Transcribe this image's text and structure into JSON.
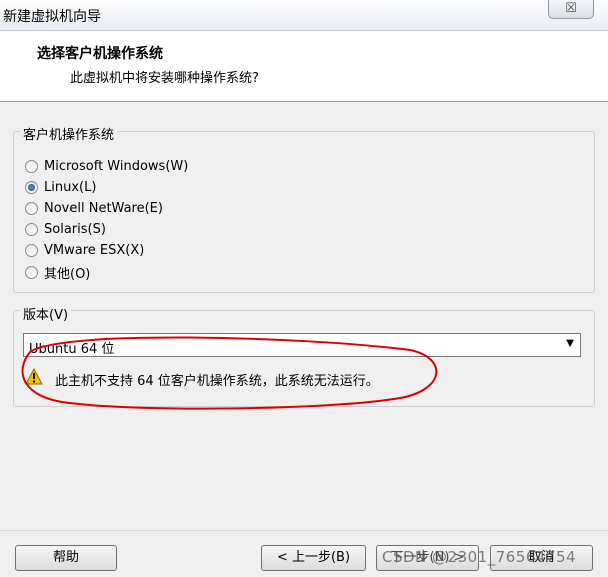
{
  "window": {
    "title": "新建虚拟机向导",
    "close_label": "☒"
  },
  "header": {
    "title": "选择客户机操作系统",
    "subtitle": "此虚拟机中将安装哪种操作系统?"
  },
  "guest_os_group": {
    "label": "客户机操作系统",
    "options": [
      {
        "label": "Microsoft Windows(W)",
        "checked": false
      },
      {
        "label": "Linux(L)",
        "checked": true
      },
      {
        "label": "Novell NetWare(E)",
        "checked": false
      },
      {
        "label": "Solaris(S)",
        "checked": false
      },
      {
        "label": "VMware ESX(X)",
        "checked": false
      },
      {
        "label": "其他(O)",
        "checked": false
      }
    ]
  },
  "version_group": {
    "label": "版本(V)",
    "selected": "Ubuntu 64 位",
    "warning": "此主机不支持 64 位客户机操作系统，此系统无法运行。"
  },
  "buttons": {
    "help": "帮助",
    "back": "< 上一步(B)",
    "next": "下一步(N) >",
    "cancel": "取消"
  },
  "watermark": "CSDN @2301_76564754",
  "colors": {
    "annotation": "#e00000",
    "warning_icon": "#f2c200"
  }
}
